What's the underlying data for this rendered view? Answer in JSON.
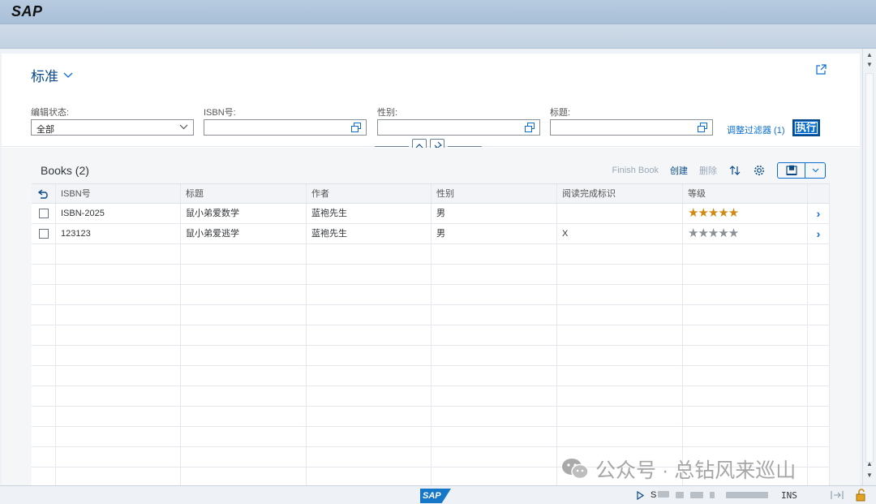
{
  "titlebar": {
    "logo": "SAP"
  },
  "page": {
    "variant": "标准",
    "filters": [
      {
        "label": "编辑状态:",
        "value": "全部",
        "kind": "dropdown"
      },
      {
        "label": "ISBN号:",
        "value": "",
        "kind": "valuehelp"
      },
      {
        "label": "性别:",
        "value": "",
        "kind": "valuehelp"
      },
      {
        "label": "标题:",
        "value": "",
        "kind": "valuehelp"
      }
    ],
    "adapt_filters": "调整过滤器 (1)",
    "go": "执行"
  },
  "table": {
    "title": "Books (2)",
    "tools": {
      "finish_book": "Finish Book",
      "create": "创建",
      "delete": "删除"
    },
    "columns": [
      "ISBN号",
      "标题",
      "作者",
      "性别",
      "阅读完成标识",
      "等级"
    ],
    "rows": [
      {
        "isbn": "ISBN-2025",
        "title": "鼠小弟爱数学",
        "author": "蓝袍先生",
        "gender": "男",
        "read_flag": "",
        "rating": "★★★★★",
        "rating_value": 5
      },
      {
        "isbn": "123123",
        "title": "鼠小弟爱逃学",
        "author": "蓝袍先生",
        "gender": "男",
        "read_flag": "X",
        "rating": "★★★★★",
        "rating_value": 0
      }
    ],
    "empty_rows": 12
  },
  "statusbar": {
    "sys_prefix": "S",
    "mode": "INS"
  },
  "watermark": "公众号 · 总钻风来巡山",
  "colors": {
    "accent": "#0a6ed1",
    "star_on": "#d08a14",
    "star_off": "#8a9096"
  }
}
